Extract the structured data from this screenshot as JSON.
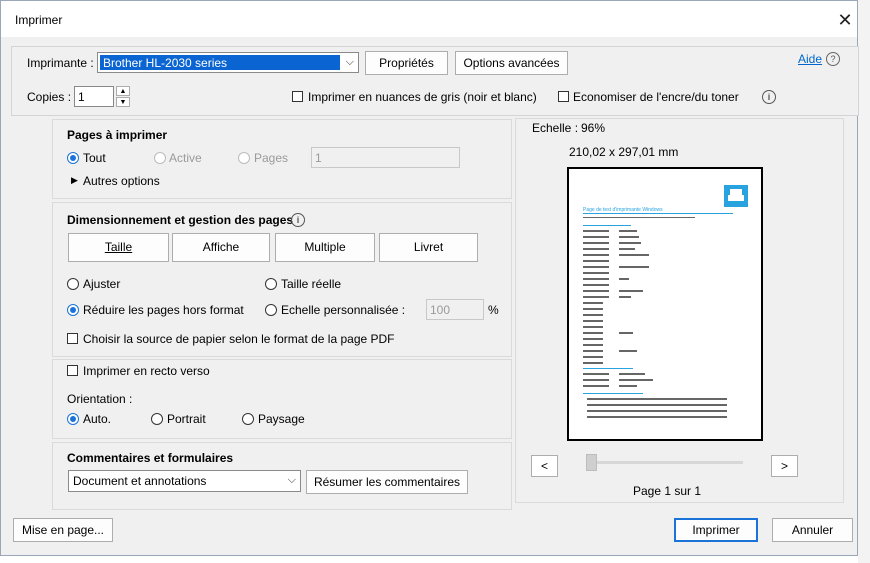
{
  "window": {
    "title": "Imprimer",
    "close_glyph": "✕"
  },
  "top": {
    "printer_label": "Imprimante :",
    "printer_value": "Brother HL-2030 series",
    "properties_button": "Propriétés",
    "advanced_button": "Options avancées",
    "help_link": "Aide",
    "copies_label": "Copies :",
    "copies_value": "1",
    "grayscale_label": "Imprimer en nuances de gris (noir et blanc)",
    "grayscale_checked": false,
    "save_ink_label": "Economiser de l'encre/du toner",
    "save_ink_checked": false
  },
  "pages": {
    "heading": "Pages à imprimer",
    "options": [
      {
        "label": "Tout",
        "selected": true,
        "disabled": false
      },
      {
        "label": "Active",
        "selected": false,
        "disabled": true
      },
      {
        "label": "Pages",
        "selected": false,
        "disabled": true
      }
    ],
    "pages_value": "1",
    "more_options": "Autres options"
  },
  "sizing": {
    "heading": "Dimensionnement et gestion des pages",
    "tabs": [
      "Taille",
      "Affiche",
      "Multiple",
      "Livret"
    ],
    "fit_label": "Ajuster",
    "actual_label": "Taille réelle",
    "shrink_label": "Réduire les pages hors format",
    "custom_label": "Echelle personnalisée :",
    "custom_value": "100",
    "percent": "%",
    "paper_source_label": "Choisir la source de papier selon le format de la page PDF"
  },
  "duplex": {
    "label": "Imprimer en recto verso"
  },
  "orientation": {
    "label": "Orientation :",
    "options": [
      {
        "label": "Auto.",
        "selected": true
      },
      {
        "label": "Portrait",
        "selected": false
      },
      {
        "label": "Paysage",
        "selected": false
      }
    ]
  },
  "comments": {
    "heading": "Commentaires et formulaires",
    "select_value": "Document et annotations",
    "summarize_button": "Résumer les commentaires"
  },
  "preview": {
    "scale_label": "Echelle :",
    "scale_value": "96%",
    "dimensions": "210,02 x 297,01 mm",
    "page_title": "Page de test d'imprimante Windows",
    "prev": "<",
    "next": ">",
    "page_indicator": "Page 1 sur 1"
  },
  "footer": {
    "page_setup_button": "Mise en page...",
    "print_button": "Imprimer",
    "cancel_button": "Annuler"
  },
  "colors": {
    "accent": "#1a73d9",
    "selection": "#0a64d2",
    "link": "#0066cc",
    "printer_icon": "#29a3e0"
  }
}
